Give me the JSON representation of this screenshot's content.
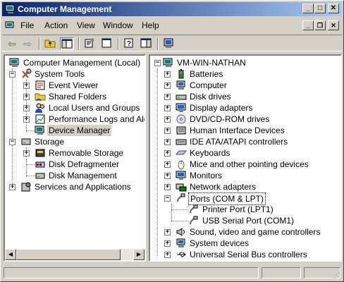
{
  "window": {
    "title": "Computer Management"
  },
  "menu": [
    "File",
    "Action",
    "View",
    "Window",
    "Help"
  ],
  "title_buttons": {
    "minimize": "_",
    "maximize": "□",
    "close": "✕"
  },
  "mdi_buttons": {
    "minimize": "_",
    "restore": "❐",
    "close": "✕"
  },
  "toolbar": [
    "back",
    "forward",
    "up",
    "show-hide-tree",
    "properties",
    "help",
    "show-hide-action-pane",
    "print"
  ],
  "left_tree": [
    {
      "label": "Computer Management (Local)",
      "icon": "computer-management-icon"
    },
    {
      "label": "System Tools",
      "icon": "system-tools-icon"
    },
    {
      "label": "Event Viewer",
      "icon": "event-viewer-icon"
    },
    {
      "label": "Shared Folders",
      "icon": "shared-folders-icon"
    },
    {
      "label": "Local Users and Groups",
      "icon": "users-icon"
    },
    {
      "label": "Performance Logs and Alerts",
      "icon": "performance-icon"
    },
    {
      "label": "Device Manager",
      "icon": "device-manager-icon"
    },
    {
      "label": "Storage",
      "icon": "storage-icon"
    },
    {
      "label": "Removable Storage",
      "icon": "removable-storage-icon"
    },
    {
      "label": "Disk Defragmenter",
      "icon": "defrag-icon"
    },
    {
      "label": "Disk Management",
      "icon": "disk-management-icon"
    },
    {
      "label": "Services and Applications",
      "icon": "services-icon"
    }
  ],
  "right_tree": [
    {
      "label": "VM-WIN-NATHAN",
      "icon": "computer-icon"
    },
    {
      "label": "Batteries",
      "icon": "battery-icon"
    },
    {
      "label": "Computer",
      "icon": "computer-icon"
    },
    {
      "label": "Disk drives",
      "icon": "disk-drive-icon"
    },
    {
      "label": "Display adapters",
      "icon": "display-icon"
    },
    {
      "label": "DVD/CD-ROM drives",
      "icon": "cdrom-icon"
    },
    {
      "label": "Human Interface Devices",
      "icon": "hid-icon"
    },
    {
      "label": "IDE ATA/ATAPI controllers",
      "icon": "ide-icon"
    },
    {
      "label": "Keyboards",
      "icon": "keyboard-icon"
    },
    {
      "label": "Mice and other pointing devices",
      "icon": "mouse-icon"
    },
    {
      "label": "Monitors",
      "icon": "monitor-icon"
    },
    {
      "label": "Network adapters",
      "icon": "network-icon"
    },
    {
      "label": "Ports (COM & LPT)",
      "icon": "port-icon"
    },
    {
      "label": "Printer Port (LPT1)",
      "icon": "port-icon"
    },
    {
      "label": "USB Serial Port (COM1)",
      "icon": "port-icon"
    },
    {
      "label": "Sound, video and game controllers",
      "icon": "sound-icon"
    },
    {
      "label": "System devices",
      "icon": "system-device-icon"
    },
    {
      "label": "Universal Serial Bus controllers",
      "icon": "usb-icon"
    }
  ]
}
